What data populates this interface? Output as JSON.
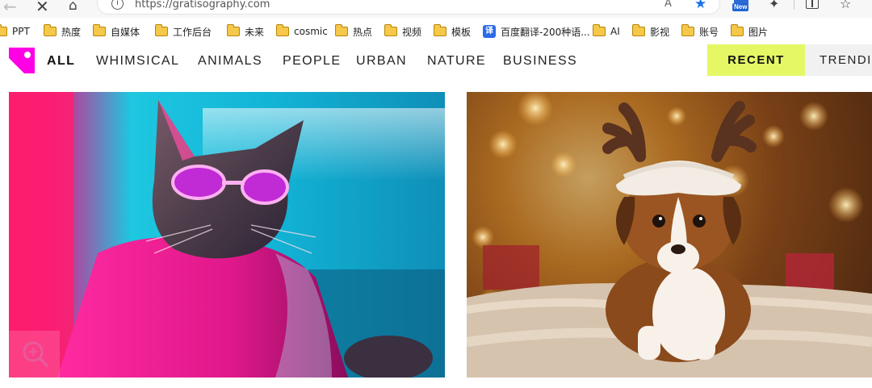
{
  "browser": {
    "url": "https://gratisography.com",
    "icons": [
      "back-icon",
      "close-icon",
      "home-icon",
      "info-icon",
      "read-aloud-icon",
      "favorite-star-icon",
      "new-app-icon",
      "extensions-icon",
      "split-screen-icon",
      "favorites-icon"
    ],
    "read_aloud_label": "Aˆ",
    "new_badge": "New"
  },
  "bookmarks": [
    {
      "label": "PPT",
      "icon": "folder-icon"
    },
    {
      "label": "热度",
      "icon": "folder-icon"
    },
    {
      "label": "自媒体",
      "icon": "folder-icon"
    },
    {
      "label": "工作后台",
      "icon": "folder-icon"
    },
    {
      "label": "未来",
      "icon": "folder-icon"
    },
    {
      "label": "cosmic",
      "icon": "folder-icon"
    },
    {
      "label": "热点",
      "icon": "folder-icon"
    },
    {
      "label": "视频",
      "icon": "folder-icon"
    },
    {
      "label": "模板",
      "icon": "folder-icon"
    },
    {
      "label": "百度翻译-200种语...",
      "icon": "translate-icon"
    },
    {
      "label": "AI",
      "icon": "folder-icon"
    },
    {
      "label": "影视",
      "icon": "folder-icon"
    },
    {
      "label": "账号",
      "icon": "folder-icon"
    },
    {
      "label": "图片",
      "icon": "folder-icon"
    }
  ],
  "site": {
    "categories": [
      "ALL",
      "WHIMSICAL",
      "ANIMALS",
      "PEOPLE",
      "URBAN",
      "NATURE",
      "BUSINESS"
    ],
    "active_category": "ALL",
    "recent_label": "RECENT",
    "trending_label": "TRENDING"
  },
  "colors": {
    "logo": "#ff00e4",
    "recent_bg": "#e6f766",
    "accent_blue": "#1a73e8"
  },
  "photos": [
    {
      "subject": "cat wearing pink sunglasses and pink jacket in neon light",
      "icon": "zoom-icon"
    },
    {
      "subject": "puppy wearing reindeer antler hat on fluffy rug with bokeh lights"
    }
  ]
}
